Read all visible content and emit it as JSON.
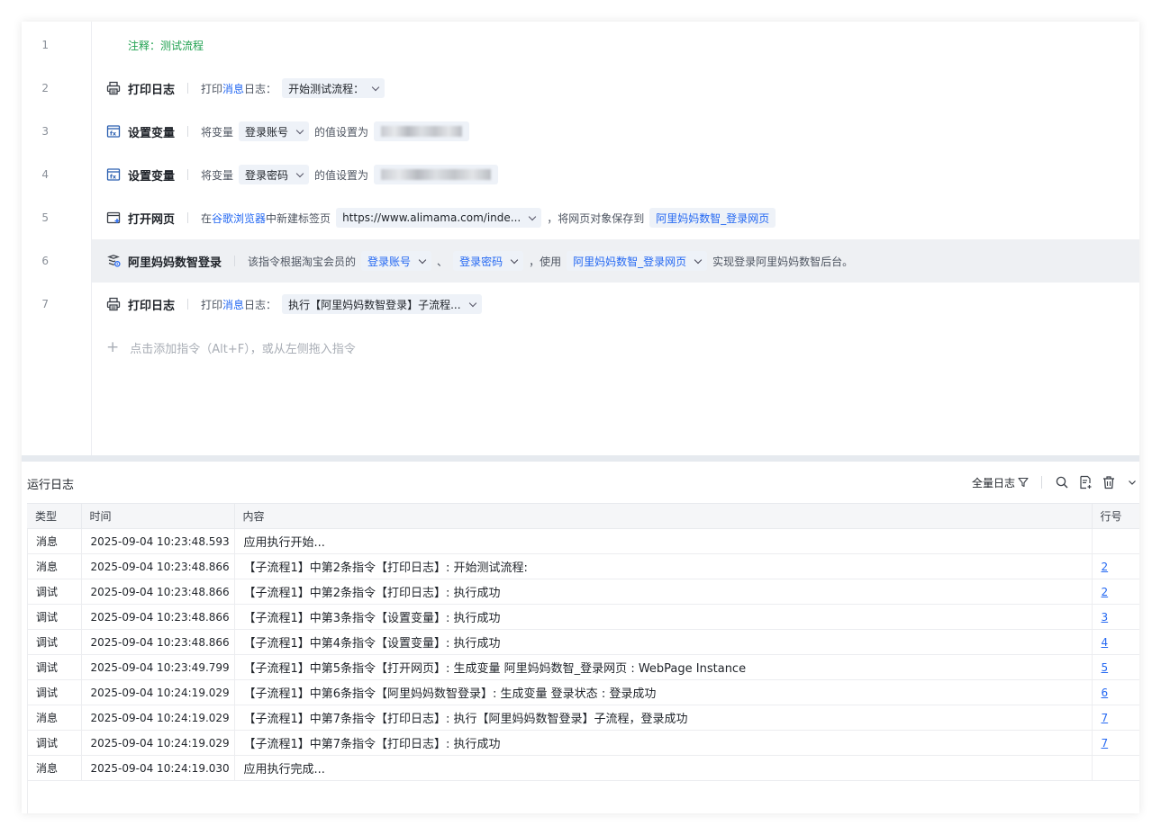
{
  "editor": {
    "line_numbers": [
      "1",
      "2",
      "3",
      "4",
      "5",
      "6",
      "7"
    ],
    "rows": [
      {
        "comment": "注释：测试流程"
      },
      {
        "cmd": "打印日志",
        "pre": "打印",
        "link": "消息",
        "post": "日志：",
        "chip": "开始测试流程："
      },
      {
        "cmd": "设置变量",
        "t1": "将变量",
        "chip": "登录账号",
        "t2": "的值设置为"
      },
      {
        "cmd": "设置变量",
        "t1": "将变量",
        "chip": "登录密码",
        "t2": "的值设置为"
      },
      {
        "cmd": "打开网页",
        "t1": "在",
        "link": "谷歌浏览器",
        "t2": "中新建标签页",
        "chip": "https://www.alimama.com/inde...",
        "t3": "，将网页对象保存到",
        "chip2": "阿里妈妈数智_登录网页"
      },
      {
        "cmd": "阿里妈妈数智登录",
        "t1": "该指令根据淘宝会员的",
        "chip": "登录账号",
        "t2": "、",
        "chip2": "登录密码",
        "t3": "，使用",
        "chip3": "阿里妈妈数智_登录网页",
        "t4": "实现登录阿里妈妈数智后台。"
      },
      {
        "cmd": "打印日志",
        "pre": "打印",
        "link": "消息",
        "post": "日志：",
        "chip": "执行【阿里妈妈数智登录】子流程..."
      }
    ],
    "add_hint": "点击添加指令（Alt+F），或从左侧拖入指令"
  },
  "log": {
    "title": "运行日志",
    "filter_label": "全量日志",
    "icons": [
      "filter-icon",
      "search-icon",
      "export-icon",
      "trash-icon",
      "chevron-down-icon"
    ],
    "columns": [
      "类型",
      "时间",
      "内容",
      "行号"
    ],
    "rows": [
      {
        "type": "消息",
        "time": "2025-09-04 10:23:48.593",
        "content": "应用执行开始...",
        "line": ""
      },
      {
        "type": "消息",
        "time": "2025-09-04 10:23:48.866",
        "content": "【子流程1】中第2条指令【打印日志】: 开始测试流程:",
        "line": "2"
      },
      {
        "type": "调试",
        "time": "2025-09-04 10:23:48.866",
        "content": "【子流程1】中第2条指令【打印日志】: 执行成功",
        "line": "2"
      },
      {
        "type": "调试",
        "time": "2025-09-04 10:23:48.866",
        "content": "【子流程1】中第3条指令【设置变量】: 执行成功",
        "line": "3"
      },
      {
        "type": "调试",
        "time": "2025-09-04 10:23:48.866",
        "content": "【子流程1】中第4条指令【设置变量】: 执行成功",
        "line": "4"
      },
      {
        "type": "调试",
        "time": "2025-09-04 10:23:49.799",
        "content": "【子流程1】中第5条指令【打开网页】: 生成变量 阿里妈妈数智_登录网页 : WebPage Instance",
        "line": "5"
      },
      {
        "type": "调试",
        "time": "2025-09-04 10:24:19.029",
        "content": "【子流程1】中第6条指令【阿里妈妈数智登录】: 生成变量 登录状态 : 登录成功",
        "line": "6"
      },
      {
        "type": "消息",
        "time": "2025-09-04 10:24:19.029",
        "content": "【子流程1】中第7条指令【打印日志】: 执行【阿里妈妈数智登录】子流程，登录成功",
        "line": "7"
      },
      {
        "type": "调试",
        "time": "2025-09-04 10:24:19.029",
        "content": "【子流程1】中第7条指令【打印日志】: 执行成功",
        "line": "7"
      },
      {
        "type": "消息",
        "time": "2025-09-04 10:24:19.030",
        "content": "应用执行完成...",
        "line": ""
      }
    ]
  }
}
